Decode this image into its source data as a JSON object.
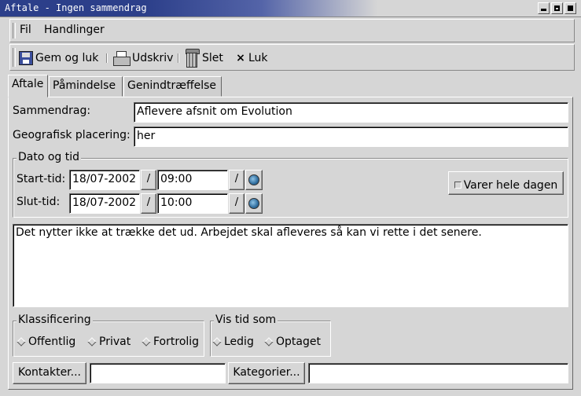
{
  "window": {
    "title": "Aftale - Ingen sammendrag"
  },
  "menu": {
    "file": "Fil",
    "actions": "Handlinger"
  },
  "toolbar": {
    "save_close": "Gem og luk",
    "print": "Udskriv",
    "delete": "Slet",
    "close": "Luk",
    "close_glyph": "×"
  },
  "tabs": [
    "Aftale",
    "Påmindelse",
    "Genindtræffelse"
  ],
  "form": {
    "summary_label": "Sammendrag:",
    "summary_value": "Aflevere afsnit om Evolution",
    "location_label": "Geografisk placering:",
    "location_value": "her"
  },
  "datetime": {
    "frame_title": "Dato og tid",
    "start_label": "Start-tid:",
    "start_date": "18/07-2002",
    "start_time": "09:00",
    "end_label": "Slut-tid:",
    "end_date": "18/07-2002",
    "end_time": "10:00",
    "all_day_label": "Varer hele dagen",
    "date_button_glyph": "/"
  },
  "description": "Det nytter ikke at trække det ud. Arbejdet skal afleveres så kan vi rette i det senere.",
  "classification": {
    "title": "Klassificering",
    "options": [
      "Offentlig",
      "Privat",
      "Fortrolig"
    ]
  },
  "show_time_as": {
    "title": "Vis tid som",
    "options": [
      "Ledig",
      "Optaget"
    ]
  },
  "bottom": {
    "contacts_label": "Kontakter...",
    "contacts_value": "",
    "categories_label": "Kategorier...",
    "categories_value": ""
  }
}
